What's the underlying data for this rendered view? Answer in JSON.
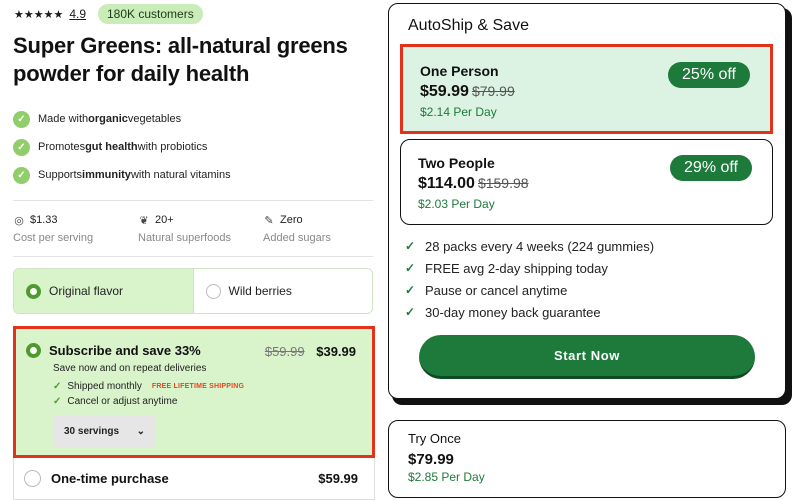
{
  "rating": {
    "stars": "★★★★★",
    "value": "4.9",
    "customers": "180K customers"
  },
  "product": {
    "title": "Super Greens: all-natural greens powder for daily health"
  },
  "benefits": [
    {
      "pre": "Made with ",
      "bold": "organic",
      "post": " vegetables"
    },
    {
      "pre": "Promotes ",
      "bold": "gut health",
      "post": " with probiotics"
    },
    {
      "pre": "Supports ",
      "bold": "immunity",
      "post": " with natural vitamins"
    }
  ],
  "stats": [
    {
      "icon": "coin-icon",
      "value": "$1.33",
      "label": "Cost per serving"
    },
    {
      "icon": "sprout-icon",
      "value": "20+",
      "label": "Natural superfoods"
    },
    {
      "icon": "leaf-icon",
      "value": "Zero",
      "label": "Added sugars"
    }
  ],
  "flavors": [
    {
      "label": "Original flavor",
      "selected": true
    },
    {
      "label": "Wild berries",
      "selected": false
    }
  ],
  "subscribe": {
    "title": "Subscribe and save 33%",
    "old_price": "$59.99",
    "new_price": "$39.99",
    "description": "Save now and on repeat deliveries",
    "feature1": "Shipped monthly",
    "free_shipping": "FREE LIFETIME SHIPPING",
    "feature2": "Cancel or adjust anytime",
    "servings": "30 servings"
  },
  "one_time": {
    "title": "One-time purchase",
    "price": "$59.99"
  },
  "autoship": {
    "title": "AutoShip & Save",
    "plans": [
      {
        "name": "One Person",
        "price": "$59.99",
        "old_price": "$79.99",
        "per_day": "$2.14 Per Day",
        "badge": "25% off"
      },
      {
        "name": "Two People",
        "price": "$114.00",
        "old_price": "$159.98",
        "per_day": "$2.03 Per Day",
        "badge": "29% off"
      }
    ],
    "perks": [
      "28 packs every 4 weeks (224 gummies)",
      "FREE avg 2-day shipping today",
      "Pause or cancel anytime",
      "30-day money back guarantee"
    ],
    "cta": "Start Now"
  },
  "try_once": {
    "title": "Try Once",
    "price": "$79.99",
    "per_day": "$2.85 Per Day"
  },
  "colors": {
    "accent_green": "#1d7a3a",
    "light_green": "#d9f3cb",
    "highlight_red": "#e3321b"
  }
}
